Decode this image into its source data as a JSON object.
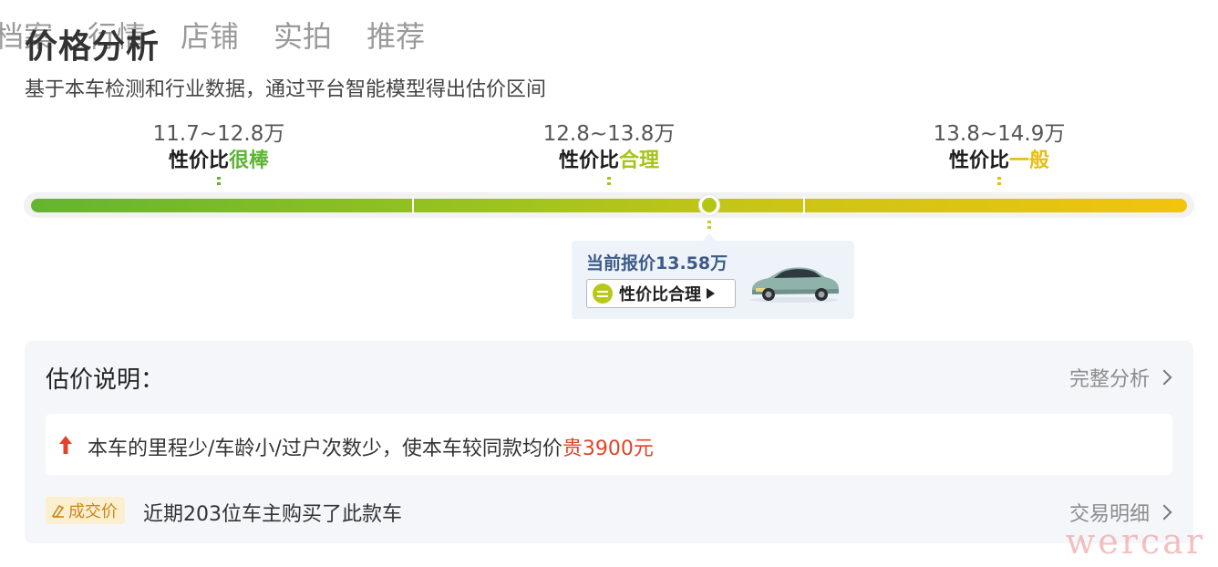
{
  "header": {
    "tabs": [
      "档案",
      "行情",
      "店铺",
      "实拍",
      "推荐"
    ],
    "title": "价格分析",
    "subtitle": "基于本车检测和行业数据，通过平台智能模型得出估价区间"
  },
  "ranges": [
    {
      "price": "11.7~12.8万",
      "prefix": "性价比",
      "level": "很棒",
      "color": "#5cb531"
    },
    {
      "price": "12.8~13.8万",
      "prefix": "性价比",
      "level": "合理",
      "color": "#a5c418"
    },
    {
      "price": "13.8~14.9万",
      "prefix": "性价比",
      "level": "一般",
      "color": "#e9bd10"
    }
  ],
  "current_price_position": 0.587,
  "quote": {
    "label": "当前报价13.58万",
    "button_label": "性价比合理"
  },
  "explain": {
    "title": "估价说明：",
    "full_analysis": "完整分析",
    "notice_prefix": "本车的里程少/车龄小/过户次数少，使本车较同款均价",
    "notice_highlight": "贵3900元",
    "deal_badge": "成交价",
    "deal_text": "近期203位车主购买了此款车",
    "trade_detail": "交易明细"
  },
  "watermark": "wercar",
  "icons": {
    "up": "arrow-up-icon",
    "neutral": "neutral-face-icon",
    "play": "play-icon",
    "chevron": "chevron-right-icon",
    "tag": "price-tag-icon"
  }
}
